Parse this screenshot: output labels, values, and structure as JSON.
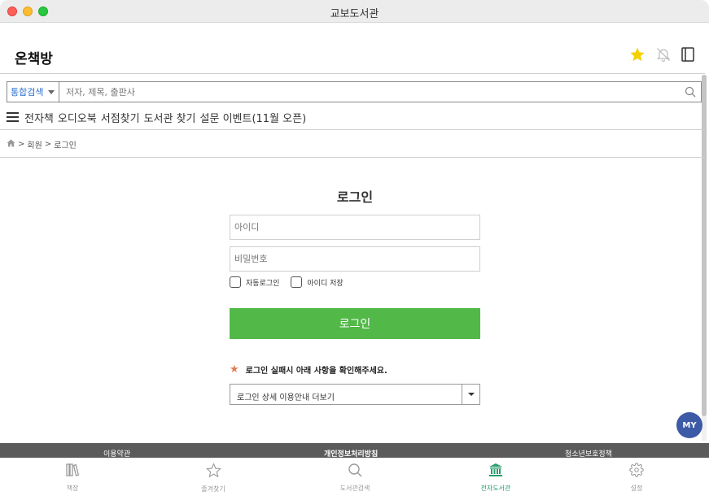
{
  "window": {
    "title": "교보도서관"
  },
  "app": {
    "title": "온책방",
    "star_icon": "star-icon",
    "bell_icon": "bell-off-icon",
    "book_icon": "book-icon",
    "star_color": "#f5d000"
  },
  "search": {
    "category": "통합검색",
    "placeholder": "저자, 제목, 출판사"
  },
  "menu": {
    "items": [
      "전자책",
      "오디오북",
      "서점찾기",
      "도서관 찾기",
      "설문 이벤트(11월 오픈)"
    ]
  },
  "breadcrumb": {
    "separator": ">",
    "items": [
      "회원",
      "로그인"
    ]
  },
  "login": {
    "title": "로그인",
    "id_placeholder": "아이디",
    "pw_placeholder": "비밀번호",
    "auto_login_label": "자동로그인",
    "save_id_label": "아이디 저장",
    "button_label": "로그인",
    "button_color": "#52b848",
    "notice": "로그인 실패시 아래 사항을 확인해주세요.",
    "dropdown_label": "로그인 상세 이용안내 더보기"
  },
  "my_button": {
    "label": "MY",
    "color": "#3d5aa6"
  },
  "footer": {
    "links": [
      "이용약관",
      "개인정보처리방침",
      "청소년보호정책"
    ]
  },
  "tabbar": {
    "items": [
      {
        "label": "책장",
        "icon": "bookshelf-icon"
      },
      {
        "label": "즐겨찾기",
        "icon": "star-outline-icon"
      },
      {
        "label": "도서관검색",
        "icon": "search-icon"
      },
      {
        "label": "전자도서관",
        "icon": "library-icon",
        "active": true
      },
      {
        "label": "설정",
        "icon": "gear-icon"
      }
    ],
    "active_color": "#2a9d6c"
  }
}
